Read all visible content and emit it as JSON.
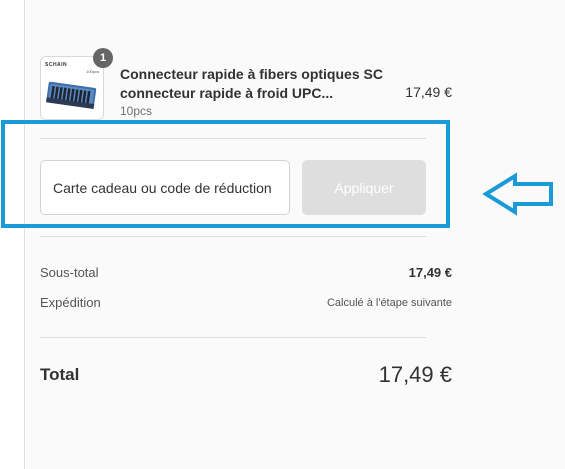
{
  "product": {
    "brand": "SCHAIN",
    "pack_count": "100pcs",
    "quantity_badge": "1",
    "name": "Connecteur rapide à fibers optiques SC connecteur rapide à froid UPC...",
    "variant": "10pcs",
    "price": "17,49 €"
  },
  "discount": {
    "placeholder": "Carte cadeau ou code de réduction",
    "apply_label": "Appliquer"
  },
  "totals": {
    "subtotal_label": "Sous-total",
    "subtotal_value": "17,49 €",
    "shipping_label": "Expédition",
    "shipping_value": "Calculé à l'étape suivante",
    "total_label": "Total",
    "total_value": "17,49 €"
  },
  "colors": {
    "highlight": "#1a9ad6",
    "badge": "#666666",
    "apply_button_disabled": "#dedede"
  },
  "icons": {
    "annotation": "left-arrow-outline-icon"
  }
}
